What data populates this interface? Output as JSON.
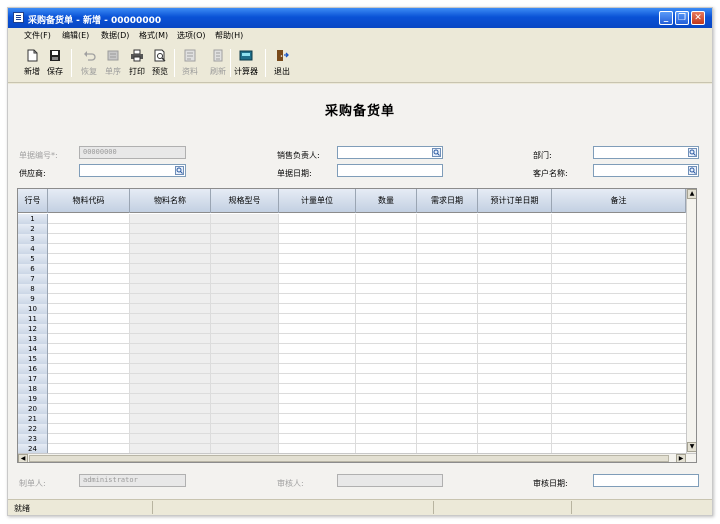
{
  "window": {
    "title": "采购备货单 - 新增 - 00000000"
  },
  "menu": [
    "文件(F)",
    "编辑(E)",
    "数据(D)",
    "格式(M)",
    "选项(O)",
    "帮助(H)"
  ],
  "toolbar": {
    "new": "新增",
    "save": "保存",
    "restore": "恢复",
    "ordering": "单序",
    "print": "打印",
    "preview": "预览",
    "data": "资料",
    "refresh": "刷新",
    "calculator": "计算器",
    "exit": "退出"
  },
  "form": {
    "title": "采购备货单",
    "doc_no_label": "单据编号*:",
    "doc_no_value": "00000000",
    "sales_person_label": "销售负责人:",
    "sales_person_value": "",
    "department_label": "部门:",
    "department_value": "",
    "supplier_label": "供应商:",
    "supplier_value": "",
    "doc_date_label": "单据日期:",
    "doc_date_value": "",
    "customer_label": "客户名称:",
    "customer_value": "",
    "creator_label": "制单人:",
    "creator_value": "administrator",
    "reviewer_label": "审核人:",
    "reviewer_value": "",
    "review_date_label": "审核日期:",
    "review_date_value": ""
  },
  "grid": {
    "columns": [
      "行号",
      "物料代码",
      "物料名称",
      "规格型号",
      "计量单位",
      "数量",
      "需求日期",
      "预计订单日期",
      "备注"
    ],
    "row_numbers": [
      "1",
      "2",
      "3",
      "4",
      "5",
      "6",
      "7",
      "8",
      "9",
      "10",
      "11",
      "12",
      "13",
      "14",
      "15",
      "16",
      "17",
      "18",
      "19",
      "20",
      "21",
      "22",
      "23",
      "24"
    ]
  },
  "status": {
    "text": "就绪"
  }
}
